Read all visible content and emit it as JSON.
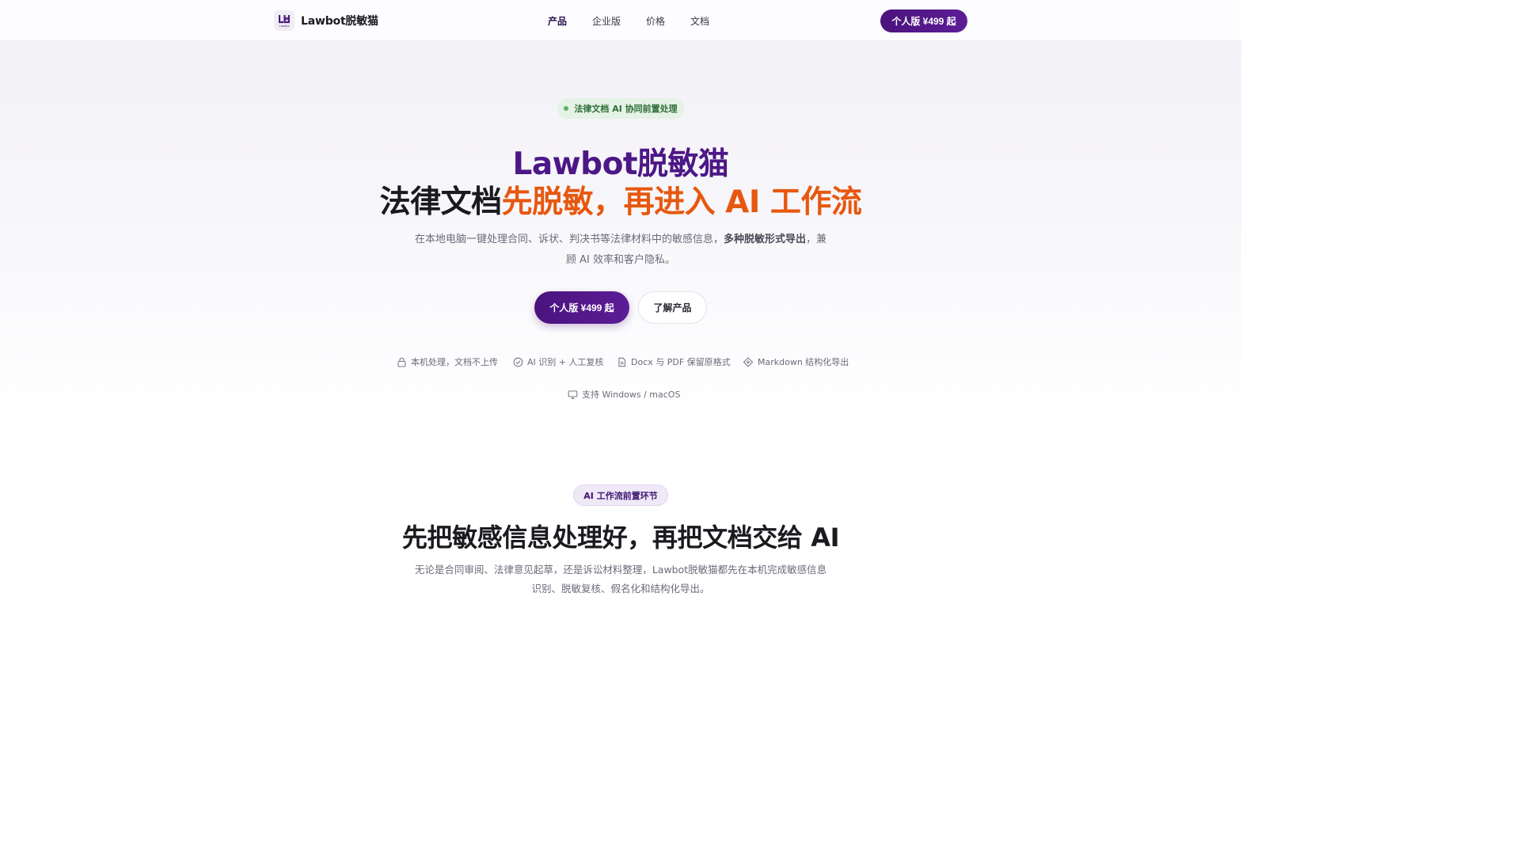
{
  "nav": {
    "brand": "Lawbot脱敏猫",
    "logo_small": "Lawbot",
    "links": [
      "产品",
      "企业版",
      "价格",
      "文档"
    ],
    "cta": "个人版 ¥499 起"
  },
  "hero": {
    "pill": "法律文档 AI 协同前置处理",
    "title_line1": "Lawbot脱敏猫",
    "title_line2_dark": "法律文档",
    "title_line2_accent": "先脱敏，再进入 AI 工作流",
    "subtitle_part1": "在本地电脑一键处理合同、诉状、判决书等法律材料中的敏感信息，",
    "subtitle_bold": "多种脱敏形式导出",
    "subtitle_part2": "，兼顾 AI 效率和客户隐私。",
    "primary_button": "个人版 ¥499 起",
    "secondary_button": "了解产品",
    "features": [
      {
        "icon": "lock-icon",
        "label": "本机处理，文档不上传"
      },
      {
        "icon": "check-circle-icon",
        "label": "AI 识别 + 人工复核"
      },
      {
        "icon": "document-icon",
        "label": "Docx 与 PDF 保留原格式"
      },
      {
        "icon": "markdown-icon",
        "label": "Markdown 结构化导出"
      },
      {
        "icon": "monitor-icon",
        "label": "支持 Windows / macOS"
      }
    ]
  },
  "section2": {
    "tag": "AI 工作流前置环节",
    "title": "先把敏感信息处理好，再把文档交给 AI",
    "subtitle": "无论是合同审阅、法律意见起草，还是诉讼材料整理，Lawbot脱敏猫都先在本机完成敏感信息识别、脱敏复核、假名化和结构化导出。"
  },
  "colors": {
    "brand_purple": "#4c1786",
    "accent_orange": "#e6580f",
    "pill_green_bg": "#e5f2e6"
  }
}
